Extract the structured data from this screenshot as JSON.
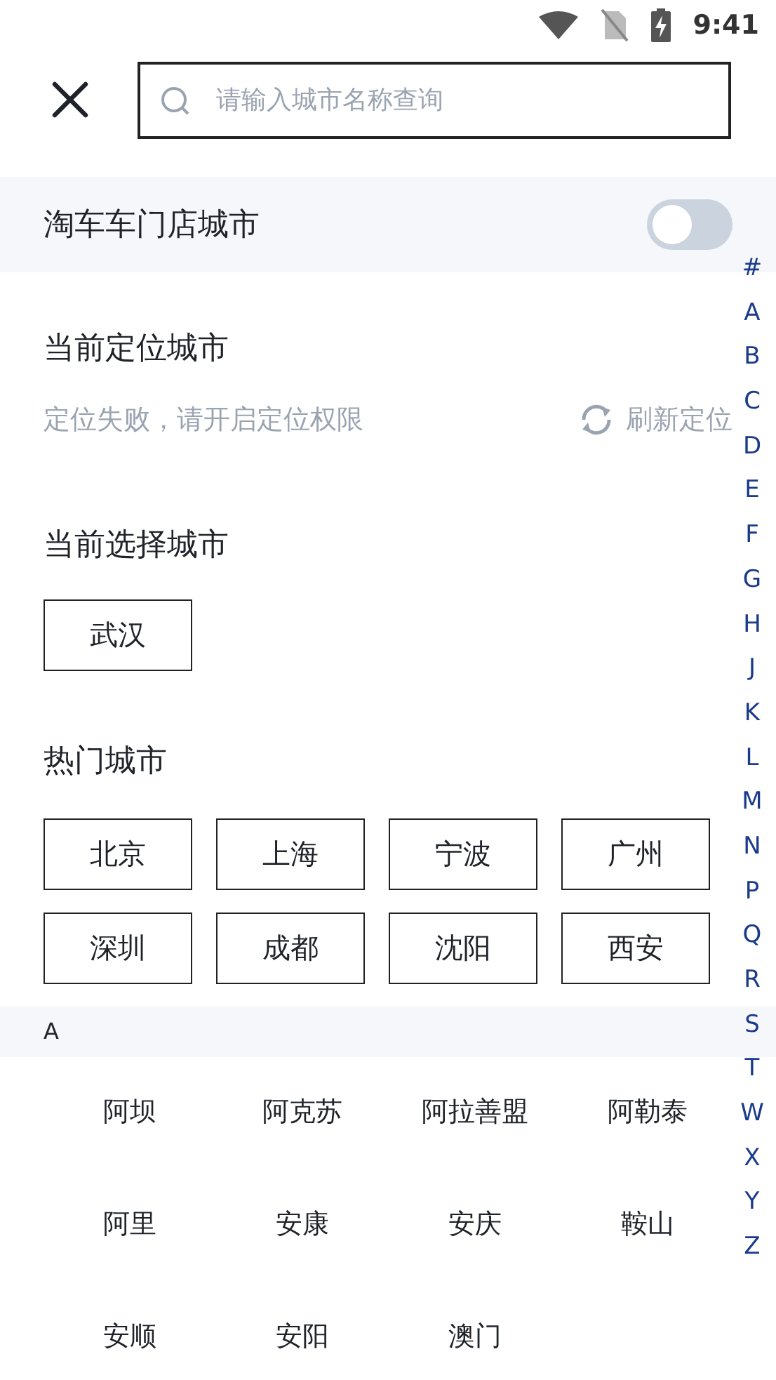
{
  "status_bar": {
    "time": "9:41"
  },
  "search": {
    "placeholder": "请输入城市名称查询"
  },
  "store_toggle": {
    "label": "淘车车门店城市",
    "on": false
  },
  "location": {
    "title": "当前定位城市",
    "message": "定位失败，请开启定位权限",
    "refresh": "刷新定位"
  },
  "current": {
    "title": "当前选择城市",
    "cities": [
      "武汉"
    ]
  },
  "hot": {
    "title": "热门城市",
    "cities": [
      "北京",
      "上海",
      "宁波",
      "广州",
      "深圳",
      "成都",
      "沈阳",
      "西安"
    ]
  },
  "groups": [
    {
      "letter": "A",
      "cities": [
        "阿坝",
        "阿克苏",
        "阿拉善盟",
        "阿勒泰",
        "阿里",
        "安康",
        "安庆",
        "鞍山",
        "安顺",
        "安阳",
        "澳门"
      ]
    }
  ],
  "index": [
    "#",
    "A",
    "B",
    "C",
    "D",
    "E",
    "F",
    "G",
    "H",
    "J",
    "K",
    "L",
    "M",
    "N",
    "P",
    "Q",
    "R",
    "S",
    "T",
    "W",
    "X",
    "Y",
    "Z"
  ]
}
